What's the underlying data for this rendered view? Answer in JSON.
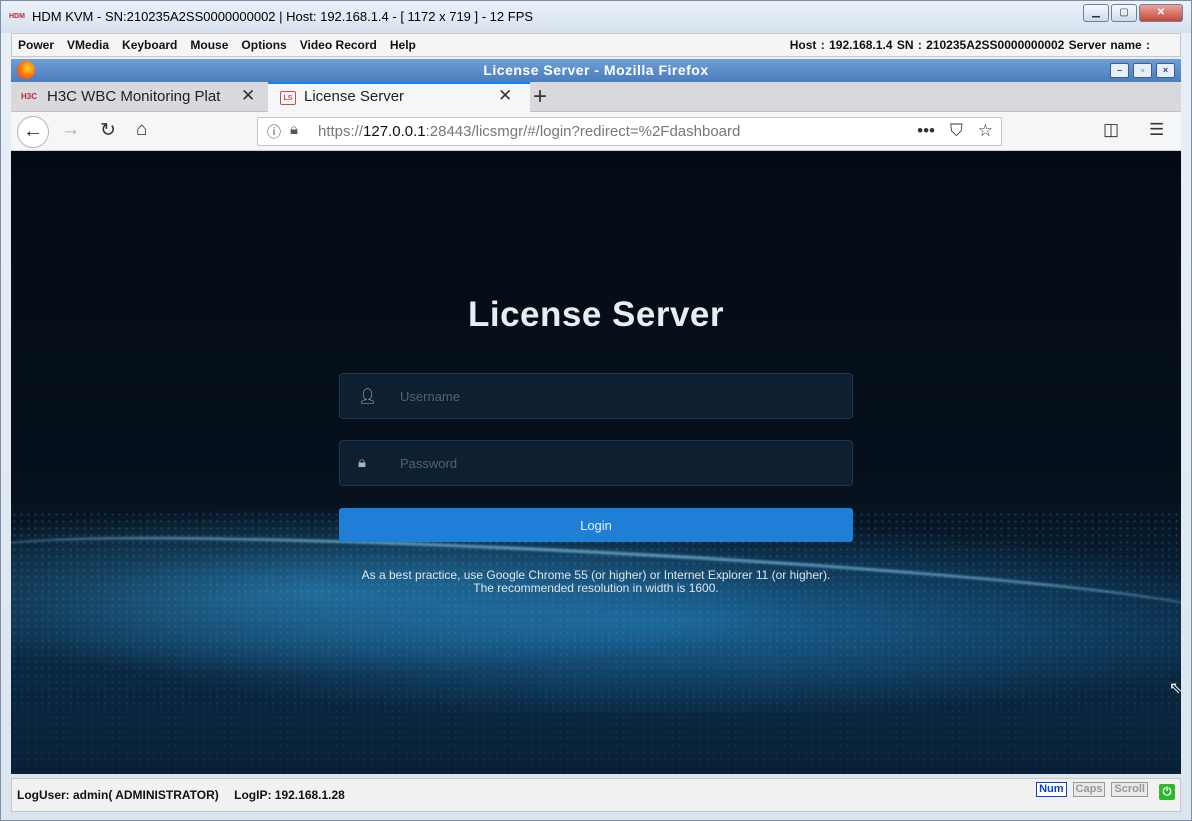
{
  "kvm": {
    "logo": "HDM",
    "title": "HDM KVM - SN:210235A2SS0000000002 | Host: 192.168.1.4 - [ 1172 x 719 ] - 12 FPS",
    "menu": [
      "Power",
      "VMedia",
      "Keyboard",
      "Mouse",
      "Options",
      "Video Record",
      "Help"
    ],
    "host_info": "Host : 192.168.1.4   SN : 210235A2SS0000000002   Server name :",
    "status": {
      "log_user": "LogUser: admin( ADMINISTRATOR)",
      "log_ip": "LogIP: 192.168.1.28",
      "num": "Num",
      "caps": "Caps",
      "scroll": "Scroll"
    }
  },
  "firefox": {
    "window_title": "License Server - Mozilla Firefox",
    "tabs": [
      {
        "favicon": "H3C",
        "label": "H3C WBC Monitoring Plat"
      },
      {
        "favicon": "LS",
        "label": "License Server"
      }
    ],
    "url": {
      "prefix": "https://",
      "host": "127.0.0.1",
      "rest": ":28443/licsmgr/#/login?redirect=%2Fdashboard"
    }
  },
  "page": {
    "title": "License Server",
    "username_placeholder": "Username",
    "password_placeholder": "Password",
    "login_label": "Login",
    "hint": "As a best practice, use Google Chrome 55 (or higher) or Internet Explorer 11 (or higher). The recommended resolution in width is 1600."
  },
  "colors": {
    "accent": "#1f7fd7",
    "background": "#06111d",
    "firefox_titlebar": "#5a8bca"
  }
}
